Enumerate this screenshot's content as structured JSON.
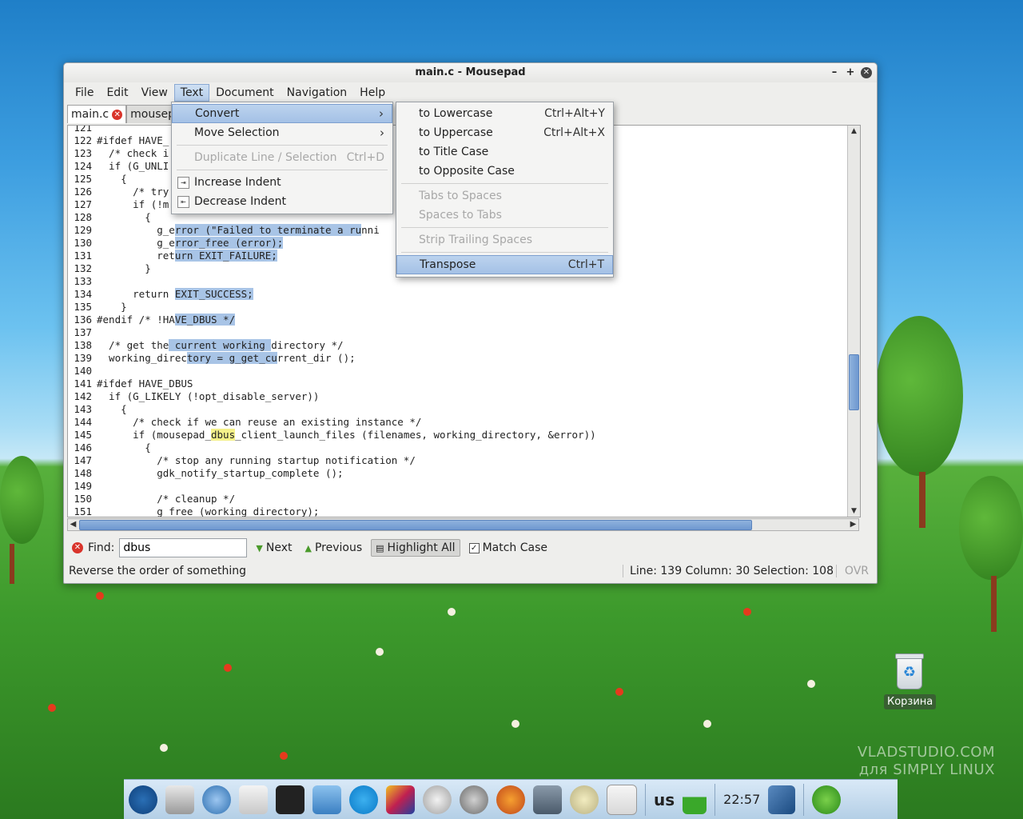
{
  "window": {
    "title": "main.c - Mousepad"
  },
  "menubar": [
    "File",
    "Edit",
    "View",
    "Text",
    "Document",
    "Navigation",
    "Help"
  ],
  "tabs": [
    {
      "label": "main.c",
      "active": true
    },
    {
      "label": "mousep",
      "active": false
    }
  ],
  "text_menu": {
    "items": [
      {
        "label": "Convert",
        "submenu": true,
        "selected": true
      },
      {
        "label": "Move Selection",
        "submenu": true
      },
      {
        "label": "Duplicate Line / Selection",
        "shortcut": "Ctrl+D",
        "disabled": true
      },
      {
        "label": "Increase Indent"
      },
      {
        "label": "Decrease Indent"
      }
    ]
  },
  "convert_menu": {
    "items": [
      {
        "label": "to Lowercase",
        "shortcut": "Ctrl+Alt+Y"
      },
      {
        "label": "to Uppercase",
        "shortcut": "Ctrl+Alt+X"
      },
      {
        "label": "to Title Case",
        "shortcut": ""
      },
      {
        "label": "to Opposite Case",
        "shortcut": ""
      },
      {
        "label": "Tabs to Spaces",
        "disabled": true
      },
      {
        "label": "Spaces to Tabs",
        "disabled": true
      },
      {
        "label": "Strip Trailing Spaces",
        "disabled": true
      },
      {
        "label": "Transpose",
        "shortcut": "Ctrl+T",
        "selected": true
      }
    ]
  },
  "code_lines": [
    {
      "n": "121",
      "t": ""
    },
    {
      "n": "122",
      "t": "#ifdef HAVE_"
    },
    {
      "n": "123",
      "t": "  /* check i"
    },
    {
      "n": "124",
      "t": "  if (G_UNLI"
    },
    {
      "n": "125",
      "t": "    {"
    },
    {
      "n": "126",
      "t": "      /* try"
    },
    {
      "n": "127",
      "t": "      if (!m"
    },
    {
      "n": "128",
      "t": "        {"
    },
    {
      "n": "129",
      "t": "          g_error (\"Failed to terminate a runni",
      "tail": ");"
    },
    {
      "n": "130",
      "t": "          g_error_free (error);"
    },
    {
      "n": "131",
      "t": "          return EXIT_FAILURE;"
    },
    {
      "n": "132",
      "t": "        }"
    },
    {
      "n": "133",
      "t": ""
    },
    {
      "n": "134",
      "t": "      return EXIT_SUCCESS;"
    },
    {
      "n": "135",
      "t": "    }"
    },
    {
      "n": "136",
      "t": "#endif /* !HAVE_DBUS */"
    },
    {
      "n": "137",
      "t": ""
    },
    {
      "n": "138",
      "t": "  /* get the current working directory */"
    },
    {
      "n": "139",
      "t": "  working_directory = g_get_current_dir ();"
    },
    {
      "n": "140",
      "t": ""
    },
    {
      "n": "141",
      "t": "#ifdef HAVE_DBUS"
    },
    {
      "n": "142",
      "t": "  if (G_LIKELY (!opt_disable_server))"
    },
    {
      "n": "143",
      "t": "    {"
    },
    {
      "n": "144",
      "t": "      /* check if we can reuse an existing instance */"
    },
    {
      "n": "145",
      "t": "      if (mousepad_dbus_client_launch_files (filenames, working_directory, &error))"
    },
    {
      "n": "146",
      "t": "        {"
    },
    {
      "n": "147",
      "t": "          /* stop any running startup notification */"
    },
    {
      "n": "148",
      "t": "          gdk_notify_startup_complete ();"
    },
    {
      "n": "149",
      "t": ""
    },
    {
      "n": "150",
      "t": "          /* cleanup */"
    },
    {
      "n": "151",
      "t": "          g_free (working_directory);"
    }
  ],
  "findbar": {
    "label": "Find:",
    "value": "dbus",
    "next": "Next",
    "previous": "Previous",
    "highlight_all": "Highlight All",
    "match_case": "Match Case"
  },
  "statusbar": {
    "message": "Reverse the order of something",
    "position": "Line: 139 Column: 30 Selection: 108",
    "mode": "OVR"
  },
  "desktop": {
    "trash_label": "Корзина",
    "watermark_line1": "VLADSTUDIO.COM",
    "watermark_line2": "для SIMPLY LINUX"
  },
  "taskbar": {
    "keyboard_layout": "us",
    "clock": "22:57"
  }
}
